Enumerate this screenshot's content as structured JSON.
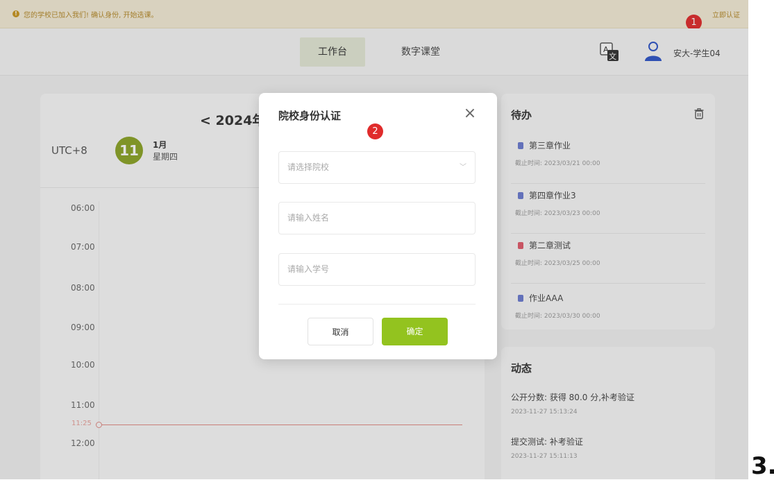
{
  "notice": {
    "message": "您的学校已加入我们! 确认身份, 开始选课。",
    "action": "立即认证"
  },
  "header": {
    "tabs": [
      {
        "label": "工作台",
        "active": true
      },
      {
        "label": "数字课堂",
        "active": false
      }
    ],
    "user_name": "安大-学生04",
    "icons": [
      "translate-icon",
      "user-icon"
    ]
  },
  "calendar": {
    "title": "< 2024年",
    "timezone": "UTC+8",
    "day": "11",
    "month": "1月",
    "weekday": "星期四",
    "times": [
      "06:00",
      "07:00",
      "08:00",
      "09:00",
      "10:00",
      "11:00",
      "12:00"
    ],
    "now": "11:25"
  },
  "todo": {
    "title": "待办",
    "items": [
      {
        "name": "第三章作业",
        "due": "截止时间: 2023/03/21 00:00",
        "icon_color": "#6b7bd0"
      },
      {
        "name": "第四章作业3",
        "due": "截止时间: 2023/03/23 00:00",
        "icon_color": "#6b7bd0"
      },
      {
        "name": "第二章测试",
        "due": "截止时间: 2023/03/25 00:00",
        "icon_color": "#e05a6a"
      },
      {
        "name": "作业AAA",
        "due": "截止时间: 2023/03/30 00:00",
        "icon_color": "#6b7bd0"
      }
    ]
  },
  "feed": {
    "title": "动态",
    "items": [
      {
        "text": "公开分数: 获得 80.0 分,补考验证",
        "time": "2023-11-27 15:13:24"
      },
      {
        "text": "提交测试: 补考验证",
        "time": "2023-11-27 15:11:13"
      }
    ]
  },
  "modal": {
    "title": "院校身份认证",
    "school_placeholder": "请选择院校",
    "name_placeholder": "请输入姓名",
    "id_placeholder": "请输入学号",
    "cancel_label": "取消",
    "confirm_label": "确定"
  },
  "badges": [
    "1",
    "2"
  ],
  "step_label": "3.",
  "colors": {
    "accent": "#93c31f",
    "badge": "#e02b2b",
    "notice_bg": "#f4ecd6"
  }
}
